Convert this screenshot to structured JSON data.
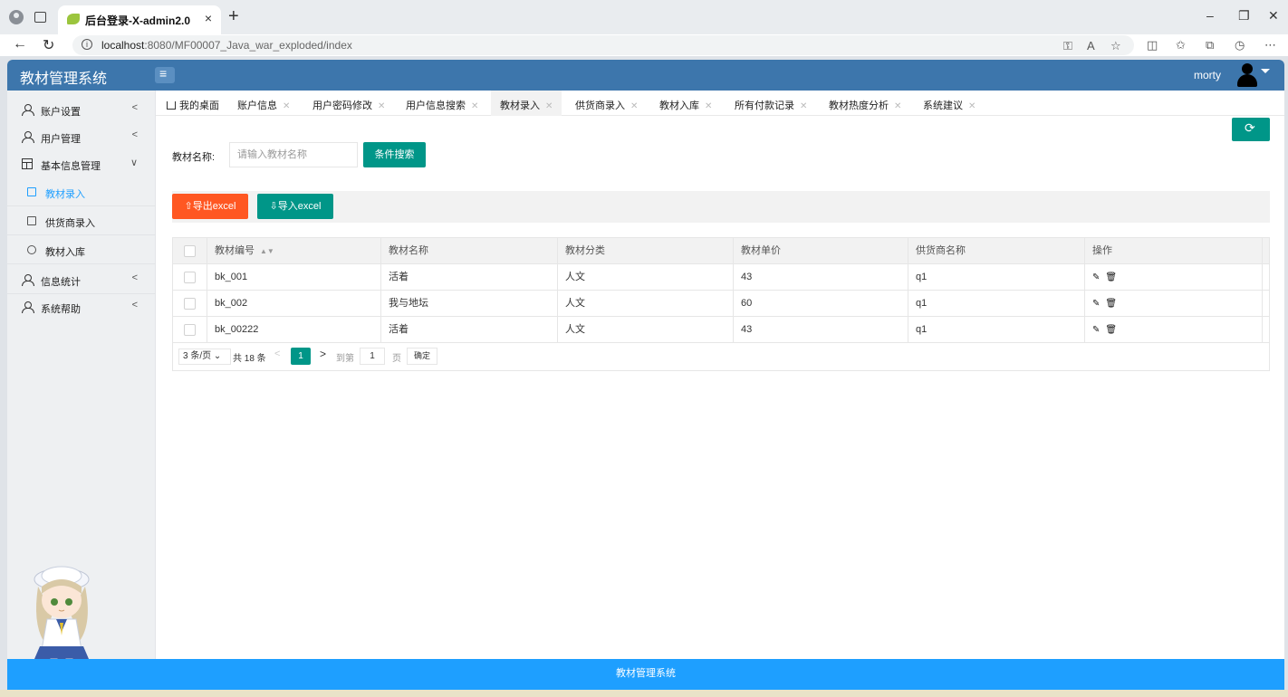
{
  "browser": {
    "tab_title": "后台登录-X-admin2.0",
    "tab_close": "×",
    "new_tab": "+",
    "url_host": "localhost",
    "url_rest": ":8080/MF00007_Java_war_exploded/index"
  },
  "header": {
    "app_title": "教材管理系统",
    "username": "morty"
  },
  "sidebar": {
    "items": [
      {
        "label": "账户设置",
        "chevron": "<"
      },
      {
        "label": "用户管理",
        "chevron": "<"
      },
      {
        "label": "基本信息管理",
        "chevron": "∨"
      },
      {
        "label": "信息统计",
        "chevron": "<"
      },
      {
        "label": "系统帮助",
        "chevron": "<"
      }
    ],
    "subitems": [
      {
        "label": "教材录入"
      },
      {
        "label": "供货商录入"
      },
      {
        "label": "教材入库"
      }
    ]
  },
  "page_tabs": [
    {
      "label": "我的桌面"
    },
    {
      "label": "账户信息"
    },
    {
      "label": "用户密码修改"
    },
    {
      "label": "用户信息搜索"
    },
    {
      "label": "教材录入"
    },
    {
      "label": "供货商录入"
    },
    {
      "label": "教材入库"
    },
    {
      "label": "所有付款记录"
    },
    {
      "label": "教材热度分析"
    },
    {
      "label": "系统建议"
    }
  ],
  "search": {
    "label": "教材名称:",
    "placeholder": "请输入教材名称",
    "button": "条件搜索"
  },
  "toolbar": {
    "export_label": "导出excel",
    "import_label": "导入excel"
  },
  "table": {
    "columns": [
      "教材编号",
      "教材名称",
      "教材分类",
      "教材单价",
      "供货商名称",
      "操作"
    ],
    "rows": [
      {
        "id": "bk_001",
        "name": "活着",
        "category": "人文",
        "price": "43",
        "supplier": "q1"
      },
      {
        "id": "bk_002",
        "name": "我与地坛",
        "category": "人文",
        "price": "60",
        "supplier": "q1"
      },
      {
        "id": "bk_00222",
        "name": "活着",
        "category": "人文",
        "price": "43",
        "supplier": "q1"
      }
    ]
  },
  "pagination": {
    "page_size": "3 条/页",
    "total": "共 18 条",
    "current_page": "1",
    "goto_label": "到第",
    "goto_value": "1",
    "page_suffix": "页",
    "confirm": "确定"
  },
  "footer": {
    "text": "教材管理系统"
  },
  "colors": {
    "header": "#3d76ac",
    "primary": "#009688",
    "danger": "#ff5722",
    "footer": "#1e9fff"
  }
}
